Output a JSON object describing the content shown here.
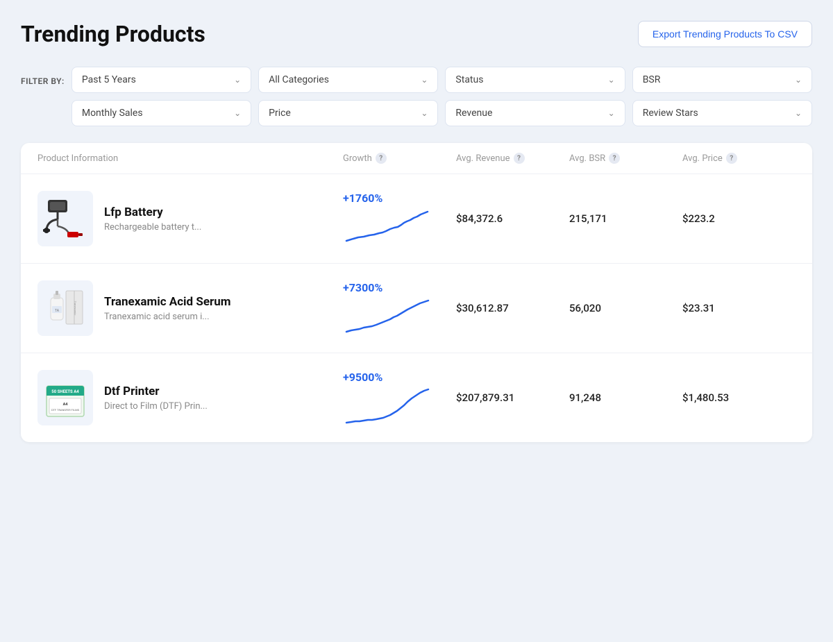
{
  "page": {
    "title": "Trending Products",
    "export_button": "Export Trending Products To CSV"
  },
  "filters": {
    "label": "FILTER BY:",
    "row1": [
      {
        "label": "Past 5 Years",
        "value": "past_5_years"
      },
      {
        "label": "All Categories",
        "value": "all_categories"
      },
      {
        "label": "Status",
        "value": "status"
      },
      {
        "label": "BSR",
        "value": "bsr"
      }
    ],
    "row2": [
      {
        "label": "Monthly Sales",
        "value": "monthly_sales"
      },
      {
        "label": "Price",
        "value": "price"
      },
      {
        "label": "Revenue",
        "value": "revenue"
      },
      {
        "label": "Review Stars",
        "value": "review_stars"
      }
    ]
  },
  "table": {
    "columns": [
      {
        "label": "Product Information",
        "has_help": false
      },
      {
        "label": "Growth",
        "has_help": true
      },
      {
        "label": "Avg. Revenue",
        "has_help": true
      },
      {
        "label": "Avg. BSR",
        "has_help": true
      },
      {
        "label": "Avg. Price",
        "has_help": true
      }
    ],
    "rows": [
      {
        "name": "Lfp Battery",
        "description": "Rechargeable battery t...",
        "growth": "+1760%",
        "avg_revenue": "$84,372.6",
        "avg_bsr": "215,171",
        "avg_price": "$223.2",
        "sparkline": "lfp"
      },
      {
        "name": "Tranexamic Acid Serum",
        "description": "Tranexamic acid serum i...",
        "growth": "+7300%",
        "avg_revenue": "$30,612.87",
        "avg_bsr": "56,020",
        "avg_price": "$23.31",
        "sparkline": "serum"
      },
      {
        "name": "Dtf Printer",
        "description": "Direct to Film (DTF) Prin...",
        "growth": "+9500%",
        "avg_revenue": "$207,879.31",
        "avg_bsr": "91,248",
        "avg_price": "$1,480.53",
        "sparkline": "dtf"
      }
    ]
  }
}
